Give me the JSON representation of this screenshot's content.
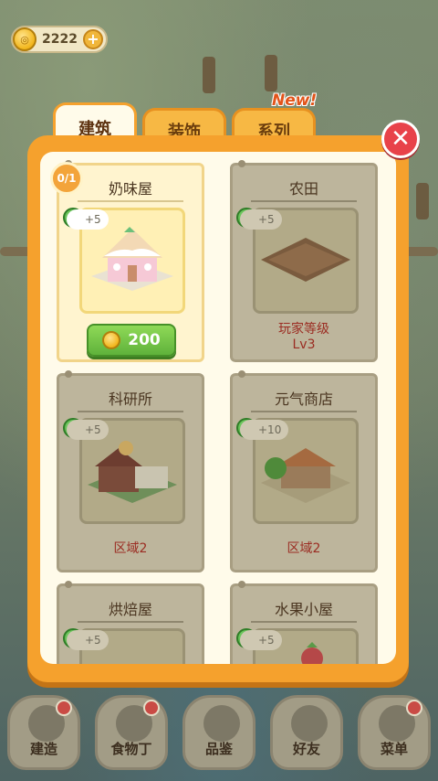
{
  "currency": {
    "amount": "2222",
    "plus_label": "+"
  },
  "dialog": {
    "tabs": [
      {
        "label": "建筑",
        "active": true
      },
      {
        "label": "装饰",
        "active": false
      },
      {
        "label": "系列",
        "active": false
      }
    ],
    "new_badge": "New!",
    "close_label": "✕",
    "items": [
      {
        "title": "奶味屋",
        "bonus": "+5",
        "count": "0/1",
        "price": "200",
        "locked": false
      },
      {
        "title": "农田",
        "bonus": "+5",
        "req1": "玩家等级",
        "req2": "Lv3",
        "locked": true
      },
      {
        "title": "科研所",
        "bonus": "+5",
        "req1": "区域2",
        "locked": true
      },
      {
        "title": "元气商店",
        "bonus": "+10",
        "req1": "区域2",
        "locked": true
      },
      {
        "title": "烘焙屋",
        "bonus": "+5",
        "locked": true
      },
      {
        "title": "水果小屋",
        "bonus": "+5",
        "locked": true
      }
    ]
  },
  "nav": [
    {
      "label": "建造"
    },
    {
      "label": "食物丁"
    },
    {
      "label": "品鉴"
    },
    {
      "label": "好友"
    },
    {
      "label": "菜单"
    }
  ],
  "colors": {
    "dialog_orange": "#f5a12d",
    "buy_green": "#6cc044",
    "requirement_red": "#9b2c22",
    "close_red": "#e8424a"
  }
}
